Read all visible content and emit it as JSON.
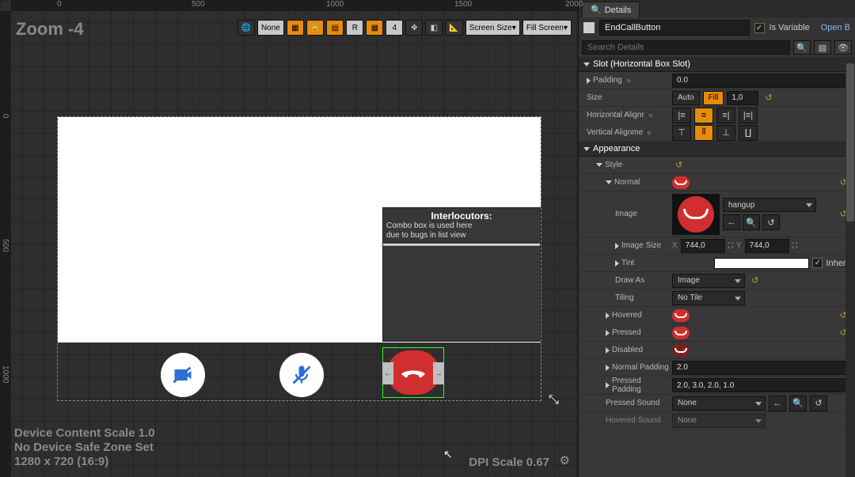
{
  "ruler_h": {
    "t0": "0",
    "t500": "500",
    "t1000": "1000",
    "t1500": "1500",
    "t2000": "2000"
  },
  "ruler_v": {
    "t0": "0",
    "t500": "500",
    "t1000": "1000"
  },
  "zoom_label": "Zoom -4",
  "toolbar": {
    "none": "None",
    "r": "R",
    "grid_num": "4",
    "screen_size": "Screen Size",
    "fill_screen": "Fill Screen"
  },
  "canvas": {
    "interlocutors_title": "Interlocutors:",
    "combo_note1": "Combo box is used here",
    "combo_note2": "due to bugs in list view"
  },
  "device_info": {
    "line1": "Device Content Scale 1.0",
    "line2": "No Device Safe Zone Set",
    "line3": "1280 x 720 (16:9)"
  },
  "dpi_label": "DPI Scale 0.67",
  "details": {
    "tab": "Details",
    "widget_name": "EndCallButton",
    "is_variable_label": "Is Variable",
    "open_label": "Open B",
    "search_placeholder": "Search Details",
    "sections": {
      "slot": "Slot (Horizontal Box Slot)",
      "appearance": "Appearance"
    },
    "slot": {
      "padding_label": "Padding",
      "padding_value": "0.0",
      "size_label": "Size",
      "size_auto": "Auto",
      "size_fill": "Fill",
      "size_value": "1,0",
      "halign_label": "Horizontal Alignr",
      "valign_label": "Vertical Alignme"
    },
    "appearance": {
      "style_label": "Style",
      "normal_label": "Normal",
      "image_label": "Image",
      "image_asset": "hangup",
      "image_size_label": "Image Size",
      "image_x": "744,0",
      "image_y": "744,0",
      "x_prefix": "X",
      "y_prefix": "Y",
      "tint_label": "Tint",
      "inherit_label": "Inherit",
      "draw_as_label": "Draw As",
      "draw_as_value": "Image",
      "tiling_label": "Tiling",
      "tiling_value": "No Tile",
      "hovered_label": "Hovered",
      "pressed_label": "Pressed",
      "disabled_label": "Disabled",
      "normal_padding_label": "Normal Padding",
      "normal_padding_value": "2.0",
      "pressed_padding_label": "Pressed Padding",
      "pressed_padding_value": "2.0, 3.0, 2.0, 1.0",
      "pressed_sound_label": "Pressed Sound",
      "pressed_sound_value": "None",
      "hovered_sound_label": "Hovered Sound",
      "hovered_sound_value": "None"
    }
  }
}
